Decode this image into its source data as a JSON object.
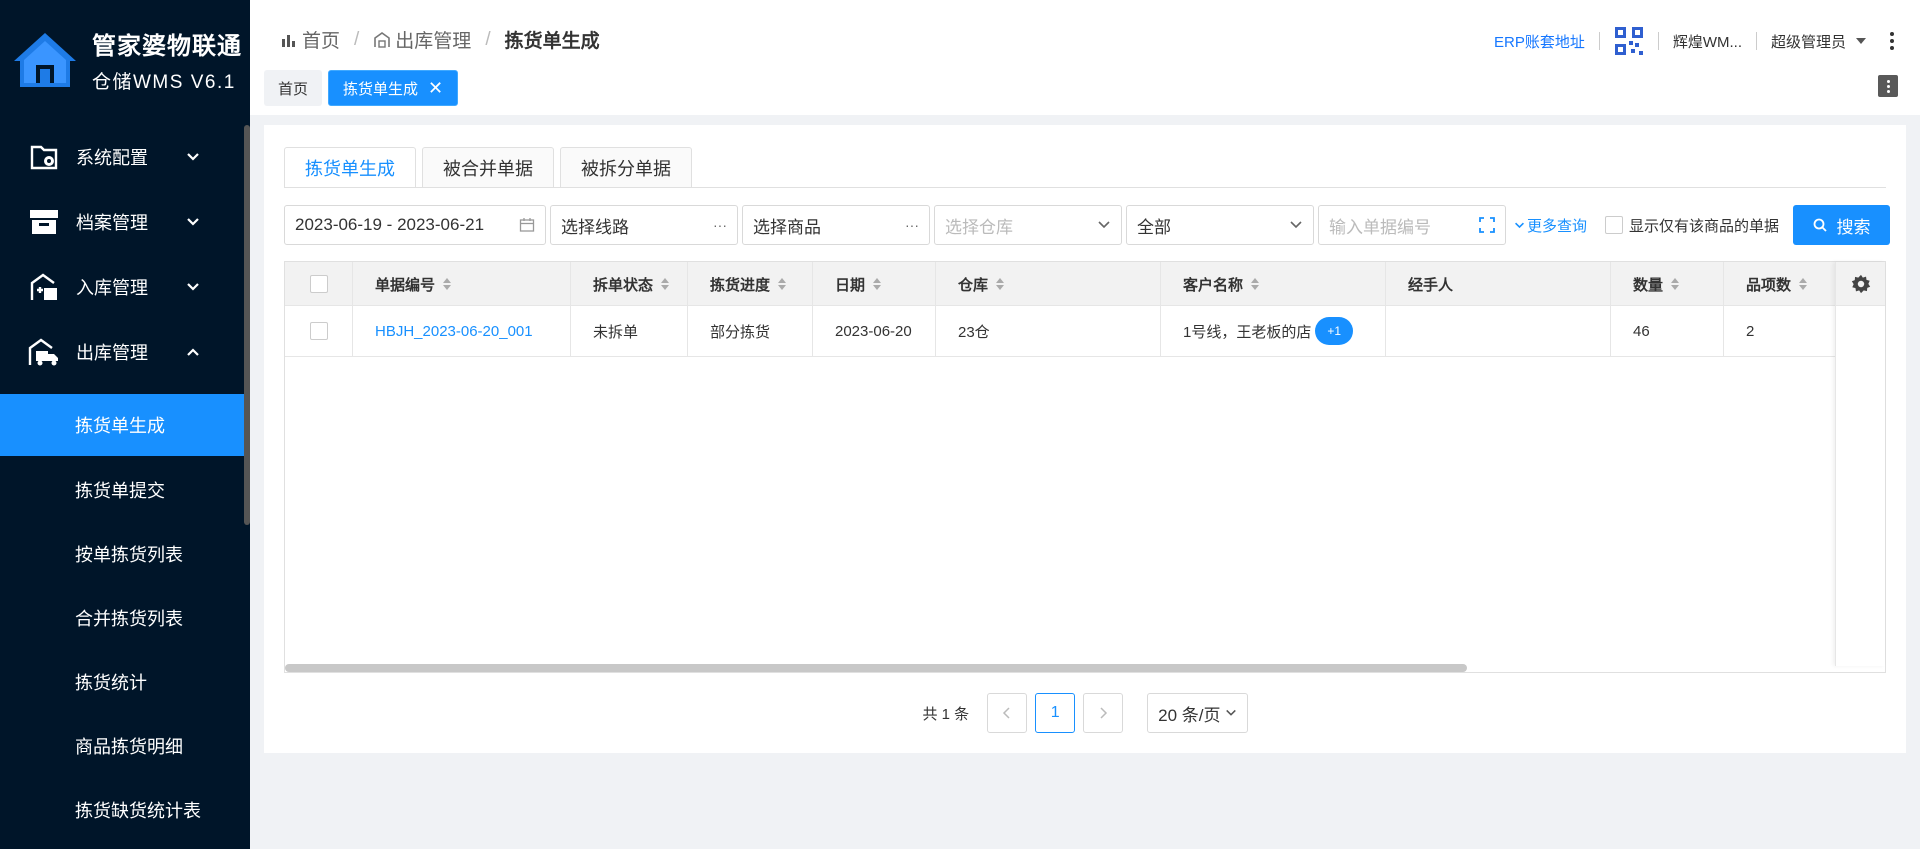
{
  "brand": {
    "title": "管家婆物联通",
    "subtitle": "仓储WMS V6.1"
  },
  "sidebar": {
    "groups": [
      {
        "label": "系统配置",
        "icon": "settings-folder-icon",
        "expanded": false
      },
      {
        "label": "档案管理",
        "icon": "archive-icon",
        "expanded": false
      },
      {
        "label": "入库管理",
        "icon": "inbound-icon",
        "expanded": false
      },
      {
        "label": "出库管理",
        "icon": "outbound-truck-icon",
        "expanded": true
      }
    ],
    "subitems": [
      {
        "label": "拣货单生成",
        "active": true
      },
      {
        "label": "拣货单提交",
        "active": false
      },
      {
        "label": "按单拣货列表",
        "active": false
      },
      {
        "label": "合并拣货列表",
        "active": false
      },
      {
        "label": "拣货统计",
        "active": false
      },
      {
        "label": "商品拣货明细",
        "active": false
      },
      {
        "label": "拣货缺货统计表",
        "active": false
      }
    ]
  },
  "header": {
    "breadcrumb": [
      "首页",
      "出库管理",
      "拣货单生成"
    ],
    "erp_link": "ERP账套地址",
    "account": "辉煌WM...",
    "role": "超级管理员"
  },
  "page_tabs": [
    {
      "label": "首页",
      "active": false
    },
    {
      "label": "拣货单生成",
      "active": true
    }
  ],
  "inner_tabs": [
    {
      "label": "拣货单生成",
      "active": true
    },
    {
      "label": "被合并单据",
      "active": false
    },
    {
      "label": "被拆分单据",
      "active": false
    }
  ],
  "filters": {
    "date_range": "2023-06-19 - 2023-06-21",
    "route_placeholder": "选择线路",
    "product_placeholder": "选择商品",
    "warehouse_placeholder": "选择仓库",
    "status_value": "全部",
    "doc_no_placeholder": "输入单据编号",
    "more_query": "更多查询",
    "only_product_label": "显示仅有该商品的单据",
    "search_label": "搜索"
  },
  "table": {
    "columns": [
      "单据编号",
      "拆单状态",
      "拣货进度",
      "日期",
      "仓库",
      "客户名称",
      "经手人",
      "数量",
      "品项数"
    ],
    "rows": [
      {
        "doc_no": "HBJH_2023-06-20_001",
        "split_status": "未拆单",
        "progress": "部分拣货",
        "date": "2023-06-20",
        "warehouse": "23仓",
        "customer": "1号线，王老板的店",
        "customer_more": "+1",
        "handler": "",
        "qty": "46",
        "items": "2"
      }
    ]
  },
  "pagination": {
    "total": "共 1 条",
    "current": "1",
    "page_size": "20 条/页"
  },
  "colors": {
    "sidebar_bg": "#001529",
    "primary": "#1890ff"
  }
}
